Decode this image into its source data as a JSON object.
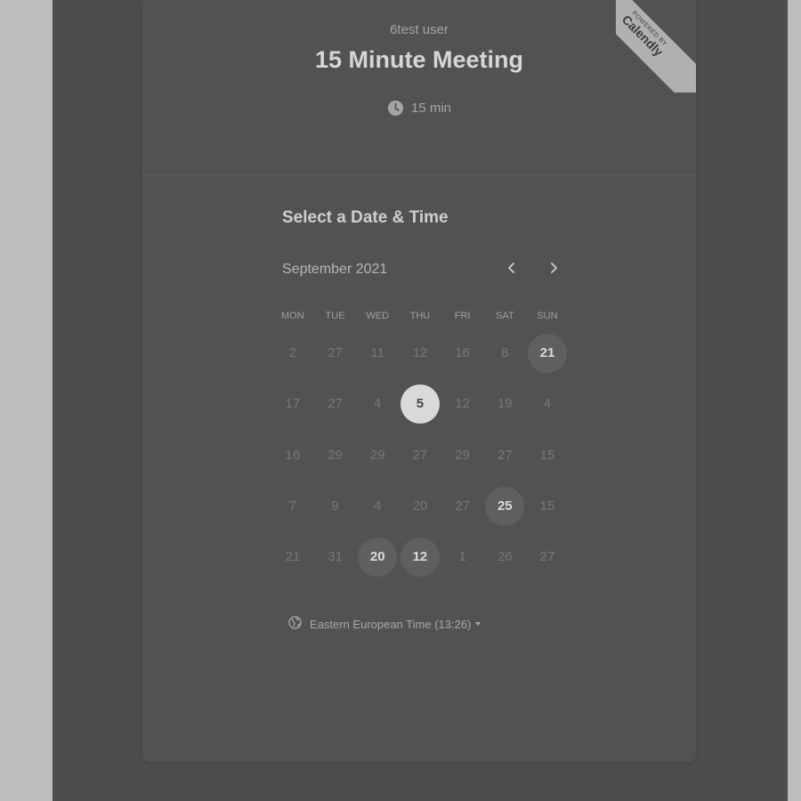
{
  "header": {
    "host_name": "6test user",
    "event_title": "15 Minute Meeting",
    "duration": "15 min",
    "duration_icon": "clock-icon"
  },
  "badge": {
    "line1": "POWERED BY",
    "line2": "Calendly"
  },
  "scheduler": {
    "section_title": "Select a Date & Time",
    "month": "September 2021",
    "prev_icon": "chevron-left-icon",
    "next_icon": "chevron-right-icon",
    "weekdays": [
      "MON",
      "TUE",
      "WED",
      "THU",
      "FRI",
      "SAT",
      "SUN"
    ],
    "weeks": [
      [
        {
          "label": "2",
          "state": "disabled"
        },
        {
          "label": "27",
          "state": "disabled"
        },
        {
          "label": "11",
          "state": "disabled"
        },
        {
          "label": "12",
          "state": "disabled"
        },
        {
          "label": "16",
          "state": "disabled"
        },
        {
          "label": "8",
          "state": "disabled"
        },
        {
          "label": "21",
          "state": "available"
        }
      ],
      [
        {
          "label": "17",
          "state": "disabled"
        },
        {
          "label": "27",
          "state": "disabled"
        },
        {
          "label": "4",
          "state": "disabled"
        },
        {
          "label": "5",
          "state": "selected"
        },
        {
          "label": "12",
          "state": "disabled"
        },
        {
          "label": "19",
          "state": "disabled"
        },
        {
          "label": "4",
          "state": "disabled"
        }
      ],
      [
        {
          "label": "16",
          "state": "disabled"
        },
        {
          "label": "29",
          "state": "disabled"
        },
        {
          "label": "29",
          "state": "disabled"
        },
        {
          "label": "27",
          "state": "disabled"
        },
        {
          "label": "29",
          "state": "disabled"
        },
        {
          "label": "27",
          "state": "disabled"
        },
        {
          "label": "15",
          "state": "disabled"
        }
      ],
      [
        {
          "label": "7",
          "state": "disabled"
        },
        {
          "label": "9",
          "state": "disabled"
        },
        {
          "label": "4",
          "state": "disabled"
        },
        {
          "label": "20",
          "state": "disabled"
        },
        {
          "label": "27",
          "state": "disabled"
        },
        {
          "label": "25",
          "state": "available"
        },
        {
          "label": "15",
          "state": "disabled"
        }
      ],
      [
        {
          "label": "21",
          "state": "disabled"
        },
        {
          "label": "31",
          "state": "disabled"
        },
        {
          "label": "20",
          "state": "available"
        },
        {
          "label": "12",
          "state": "available"
        },
        {
          "label": "1",
          "state": "disabled"
        },
        {
          "label": "26",
          "state": "disabled"
        },
        {
          "label": "27",
          "state": "disabled"
        }
      ]
    ],
    "timezone": "Eastern European Time (13:26)",
    "timezone_icon": "globe-icon"
  },
  "colors": {
    "page_background": "#bdbdbd",
    "backdrop": "#4d4d4d",
    "card": "#525252",
    "selected_day": "#d9d9d9",
    "available_day": "#5f5f5f"
  }
}
